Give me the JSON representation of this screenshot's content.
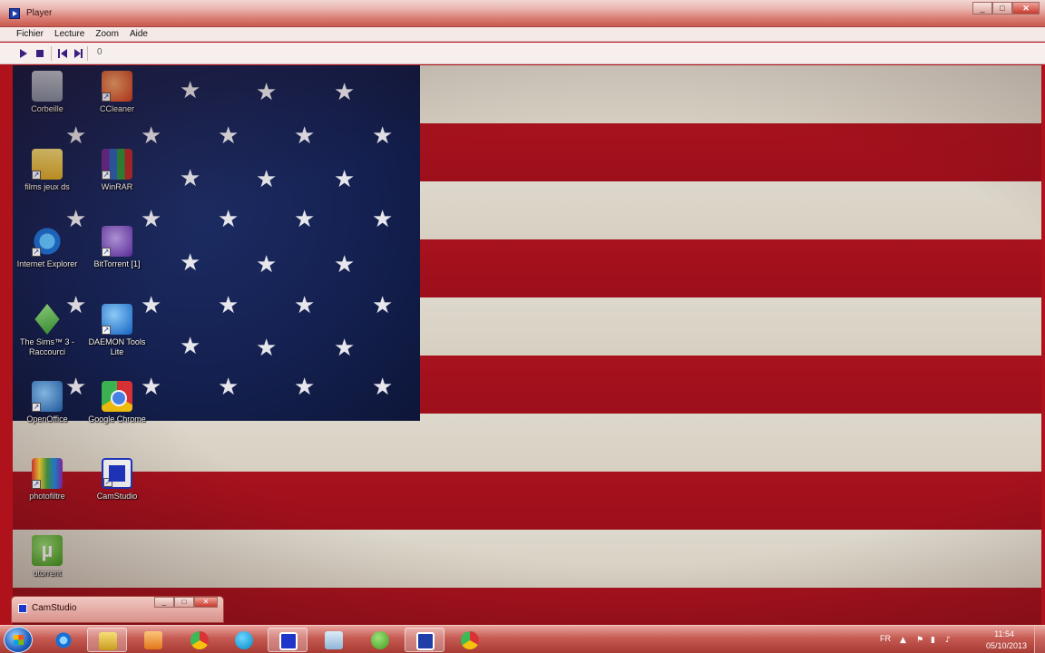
{
  "window": {
    "title": "Player",
    "controls": [
      "_",
      "□",
      "✕"
    ]
  },
  "menubar": {
    "items": [
      "Fichier",
      "Lecture",
      "Zoom",
      "Aide"
    ]
  },
  "toolbar": {
    "frame_counter": "0"
  },
  "desktop": {
    "icons": [
      {
        "label": "Corbeille",
        "icon": "recycle-bin-icon"
      },
      {
        "label": "CCleaner",
        "icon": "ccleaner-icon"
      },
      {
        "label": "films jeux ds",
        "icon": "folder-icon"
      },
      {
        "label": "WinRAR",
        "icon": "winrar-icon"
      },
      {
        "label": "Internet Explorer",
        "icon": "internet-explorer-icon"
      },
      {
        "label": "BitTorrent [1]",
        "icon": "bittorrent-icon"
      },
      {
        "label": "The Sims™ 3 - Raccourci",
        "icon": "sims-icon"
      },
      {
        "label": "DAEMON Tools Lite",
        "icon": "daemon-tools-icon"
      },
      {
        "label": "OpenOffice",
        "icon": "openoffice-icon"
      },
      {
        "label": "Google Chrome",
        "icon": "chrome-icon"
      },
      {
        "label": "photofiltre",
        "icon": "photofiltre-icon"
      },
      {
        "label": "CamStudio",
        "icon": "camstudio-icon"
      },
      {
        "label": "utorrent",
        "icon": "utorrent-icon"
      }
    ]
  },
  "minimized_window": {
    "title": "CamStudio"
  },
  "taskbar": {
    "apps": [
      {
        "icon": "internet-explorer-icon",
        "color": "#1b6fd1"
      },
      {
        "icon": "file-explorer-icon",
        "color": "#e6c14a"
      },
      {
        "icon": "media-player-icon",
        "color": "#f08a24"
      },
      {
        "icon": "chrome-icon",
        "color": "#3cba54"
      },
      {
        "icon": "skype-icon",
        "color": "#00aff0"
      },
      {
        "icon": "camstudio-icon",
        "color": "#1d36c9"
      },
      {
        "icon": "window-icon",
        "color": "#9fc3e0"
      },
      {
        "icon": "utorrent-icon",
        "color": "#5ab52d"
      },
      {
        "icon": "player-icon",
        "color": "#1f3ea8"
      },
      {
        "icon": "chrome-icon",
        "color": "#db3236"
      }
    ],
    "tray": {
      "language": "FR",
      "time": "11:54",
      "date": "05/10/2013"
    }
  }
}
